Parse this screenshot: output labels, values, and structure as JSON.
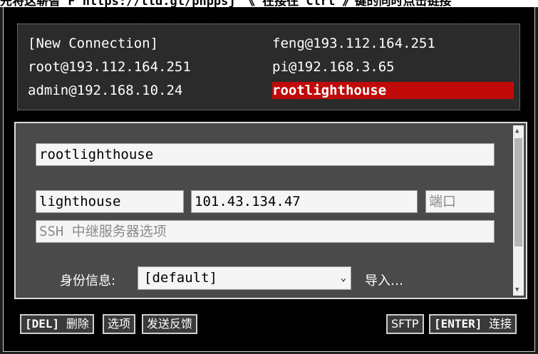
{
  "top_banner": "先将这崭智 F https://ttd.gl/pnppsj 《 在接往 Ctrl 》键的同时点击链接",
  "connections": [
    {
      "label": "[New Connection]",
      "selected": false
    },
    {
      "label": "feng@193.112.164.251",
      "selected": false
    },
    {
      "label": "root@193.112.164.251",
      "selected": false
    },
    {
      "label": "pi@192.168.3.65",
      "selected": false
    },
    {
      "label": "admin@192.168.10.24",
      "selected": false
    },
    {
      "label": "rootlighthouse",
      "selected": true
    }
  ],
  "form": {
    "name_value": "rootlighthouse",
    "user_value": "lighthouse",
    "host_value": "101.43.134.47",
    "port_placeholder": "端口",
    "ssh_relay_placeholder": "SSH 中继服务器选项",
    "identity_label": "身份信息:",
    "identity_value": "[default]",
    "import_label": "导入…"
  },
  "buttons": {
    "delete_key": "[DEL]",
    "delete_label": "删除",
    "options_label": "选项",
    "feedback_label": "发送反馈",
    "sftp_label": "SFTP",
    "connect_key": "[ENTER]",
    "connect_label": "连接"
  },
  "colors": {
    "selected_highlight": "#c00a0a",
    "background": "#000000",
    "panel": "#2b2b2b"
  }
}
